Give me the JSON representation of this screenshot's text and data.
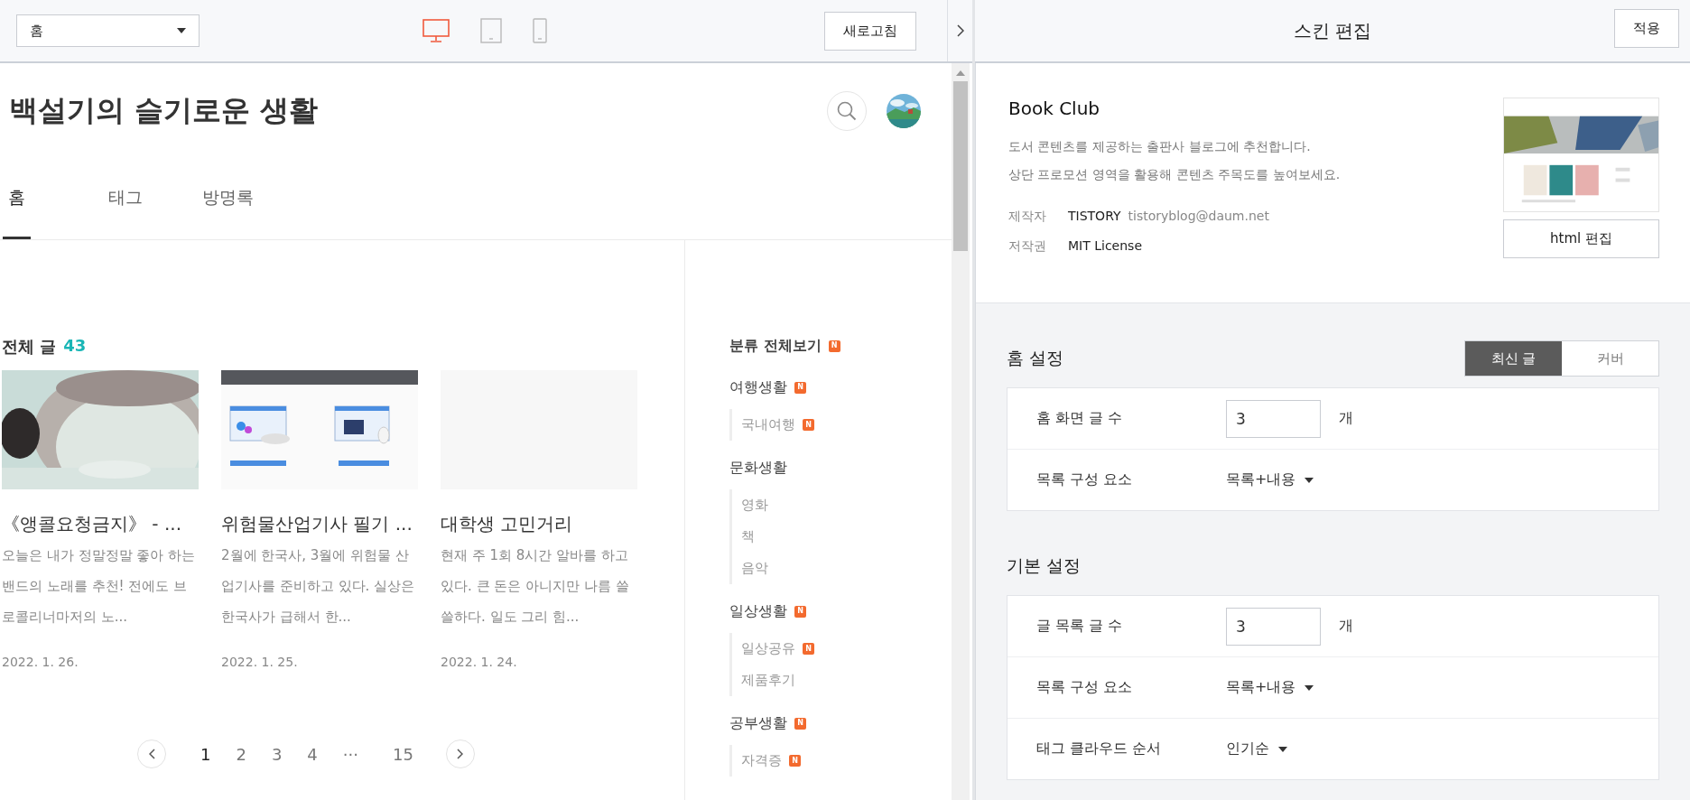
{
  "preview": {
    "page_select": {
      "value": "홈"
    },
    "devices": [
      {
        "kind": "desktop",
        "selected": true
      },
      {
        "kind": "tablet",
        "selected": false
      },
      {
        "kind": "mobile",
        "selected": false
      }
    ],
    "refresh_button": "새로고침",
    "blog": {
      "title": "백설기의 슬기로운 생활",
      "tabs": [
        {
          "label": "홈",
          "selected": true
        },
        {
          "label": "태그",
          "selected": false
        },
        {
          "label": "방명록",
          "selected": false
        }
      ],
      "posts_heading": {
        "label": "전체 글",
        "count": "43"
      },
      "posts": [
        {
          "title": "《앵콜요청금지》 - ...",
          "excerpt": "오늘은 내가 정말정말 좋아 하는 밴드의 노래를 추천! 전에도 브로콜리너마저의 노...",
          "date": "2022. 1. 26."
        },
        {
          "image": {
            "kind": "banner"
          },
          "title": "위험물산업기사 필기 ...",
          "excerpt": "2월에 한국사, 3월에 위험물 산업기사를 준비하고 있다. 실상은 한국사가 급해서 한...",
          "date": "2022. 1. 25."
        },
        {
          "image": {
            "kind": "empty"
          },
          "title": "대학생 고민거리",
          "excerpt": "현재 주 1회 8시간 알바를 하고 있다. 큰 돈은 아니지만 나름 쓸쓸하다. 일도 그리 힘...",
          "date": "2022. 1. 24."
        }
      ],
      "pagination": [
        {
          "label": "1",
          "selected": true
        },
        {
          "label": "2",
          "selected": false
        },
        {
          "label": "3",
          "selected": false
        },
        {
          "label": "4",
          "selected": false
        },
        {
          "label": "···",
          "selected": false
        },
        {
          "label": "15",
          "selected": false
        }
      ],
      "categories": {
        "label": "분류 전체보기",
        "badge": "N",
        "items": [
          {
            "label": "여행생활",
            "badge": "N",
            "children": [
              {
                "label": "국내여행",
                "badge": "N"
              }
            ]
          },
          {
            "label": "문화생활",
            "children": [
              {
                "label": "영화"
              },
              {
                "label": "책"
              },
              {
                "label": "음악"
              }
            ]
          },
          {
            "label": "일상생활",
            "badge": "N",
            "children": [
              {
                "label": "일상공유",
                "badge": "N"
              },
              {
                "label": "제품후기"
              }
            ]
          },
          {
            "label": "공부생활",
            "badge": "N",
            "children": [
              {
                "label": "자격증",
                "badge": "N"
              }
            ]
          }
        ]
      }
    }
  },
  "editor": {
    "title": "스킨 편집",
    "apply_button": "적용",
    "skin": {
      "name": "Book Club",
      "description": [
        "도서 콘텐츠를 제공하는 출판사 블로그에 추천합니다.",
        "상단 프로모션 영역을 활용해 콘텐츠 주목도를 높여보세요."
      ],
      "meta": [
        {
          "label": "제작자",
          "value": "TISTORY",
          "extra": "tistoryblog@daum.net"
        },
        {
          "label": "저작권",
          "value": "MIT License"
        }
      ],
      "html_button": "html 편집"
    },
    "sections": [
      {
        "title": "홈 설정",
        "toggle": [
          {
            "label": "최신 글",
            "selected": true
          },
          {
            "label": "커버",
            "selected": false
          }
        ],
        "rows": [
          {
            "kind": "number",
            "label": "홈 화면 글 수",
            "value": "3",
            "unit": "개"
          },
          {
            "kind": "select",
            "label": "목록 구성 요소",
            "value": "목록+내용"
          }
        ]
      },
      {
        "title": "기본 설정",
        "rows": [
          {
            "kind": "number",
            "label": "글 목록 글 수",
            "value": "3",
            "unit": "개"
          },
          {
            "kind": "select",
            "label": "목록 구성 요소",
            "value": "목록+내용"
          },
          {
            "kind": "select",
            "label": "태그 클라우드 순서",
            "value": "인기순"
          }
        ]
      }
    ]
  }
}
